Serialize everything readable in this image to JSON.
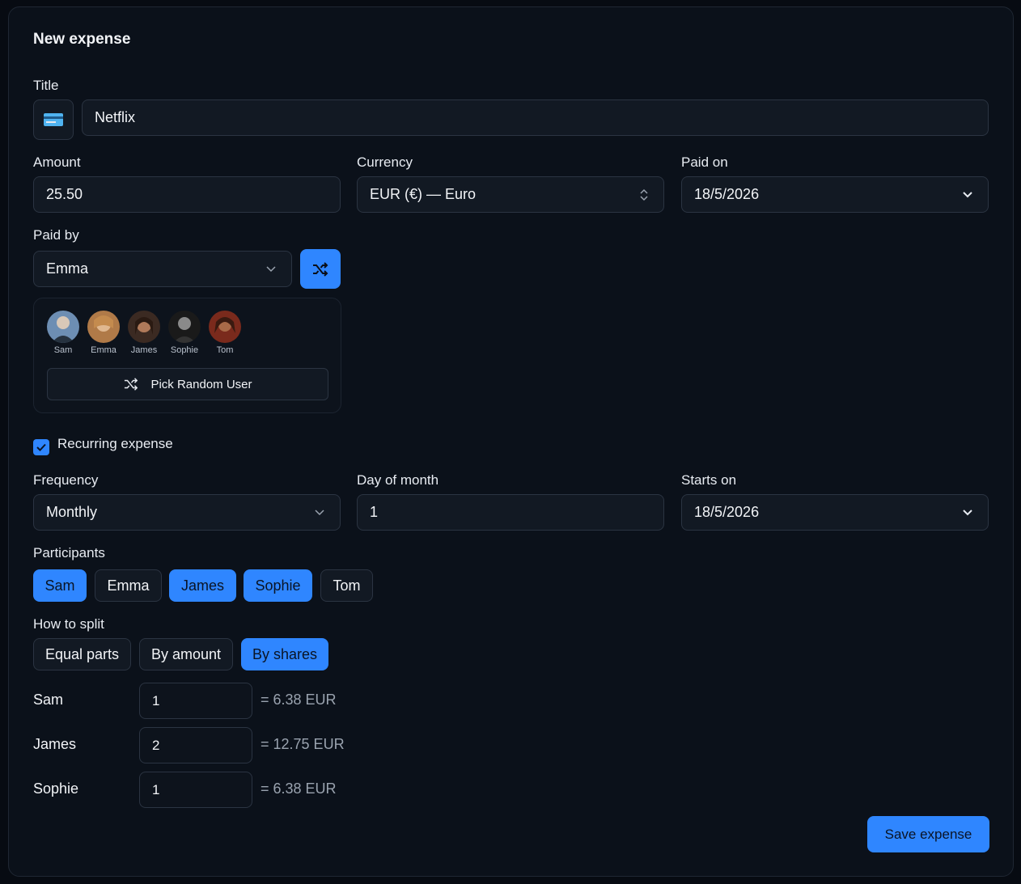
{
  "form": {
    "title": "New expense"
  },
  "title_field": {
    "label": "Title",
    "value": "Netflix",
    "icon": "credit-card-icon"
  },
  "amount": {
    "label": "Amount",
    "value": "25.50"
  },
  "currency": {
    "label": "Currency",
    "value": "EUR (€) — Euro"
  },
  "paid_on": {
    "label": "Paid on",
    "value": "18/5/2026"
  },
  "paid_by": {
    "label": "Paid by",
    "value": "Emma",
    "users": [
      {
        "name": "Sam",
        "color": "#5a7fa6"
      },
      {
        "name": "Emma",
        "color": "#c2844a"
      },
      {
        "name": "James",
        "color": "#8a5a3c"
      },
      {
        "name": "Sophie",
        "color": "#2a2a2a"
      },
      {
        "name": "Tom",
        "color": "#9b3a28"
      }
    ],
    "pick_random_label": "Pick Random User"
  },
  "recurring": {
    "label": "Recurring expense",
    "checked": true
  },
  "frequency": {
    "label": "Frequency",
    "value": "Monthly"
  },
  "day_of_month": {
    "label": "Day of month",
    "value": "1"
  },
  "starts_on": {
    "label": "Starts on",
    "value": "18/5/2026"
  },
  "participants": {
    "label": "Participants",
    "items": [
      {
        "name": "Sam",
        "selected": true
      },
      {
        "name": "Emma",
        "selected": false
      },
      {
        "name": "James",
        "selected": true
      },
      {
        "name": "Sophie",
        "selected": true
      },
      {
        "name": "Tom",
        "selected": false
      }
    ]
  },
  "split": {
    "label": "How to split",
    "options": [
      {
        "label": "Equal parts",
        "selected": false
      },
      {
        "label": "By amount",
        "selected": false
      },
      {
        "label": "By shares",
        "selected": true
      }
    ],
    "rows": [
      {
        "name": "Sam",
        "shares": "1",
        "result": "= 6.38 EUR"
      },
      {
        "name": "James",
        "shares": "2",
        "result": "= 12.75 EUR"
      },
      {
        "name": "Sophie",
        "shares": "1",
        "result": "= 6.38 EUR"
      }
    ]
  },
  "save_label": "Save expense",
  "colors": {
    "accent": "#2f86ff",
    "background": "#0b111a",
    "field": "#121923"
  }
}
